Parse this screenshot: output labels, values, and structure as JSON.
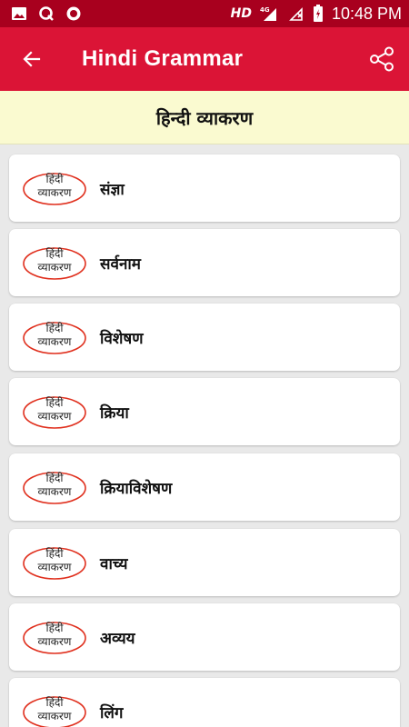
{
  "status_bar": {
    "hd": "HD",
    "network": "4G",
    "time": "10:48 PM",
    "icons": [
      "image-icon",
      "q-icon",
      "record-icon",
      "hd-icon",
      "signal-icon",
      "wifi-off-icon",
      "battery-icon"
    ]
  },
  "app_bar": {
    "title": "Hindi Grammar",
    "back_icon": "arrow-left-icon",
    "share_icon": "share-icon",
    "color": "#db1436"
  },
  "banner": {
    "title": "हिन्दी व्याकरण",
    "color": "#fafad0"
  },
  "logo": {
    "line1": "हिंदी",
    "line2": "व्याकरण",
    "ring_color": "#e0301e"
  },
  "items": [
    {
      "label": "संज्ञा"
    },
    {
      "label": "सर्वनाम"
    },
    {
      "label": "विशेषण"
    },
    {
      "label": "क्रिया"
    },
    {
      "label": "क्रियाविशेषण"
    },
    {
      "label": "वाच्य"
    },
    {
      "label": "अव्यय"
    },
    {
      "label": "लिंग"
    }
  ]
}
